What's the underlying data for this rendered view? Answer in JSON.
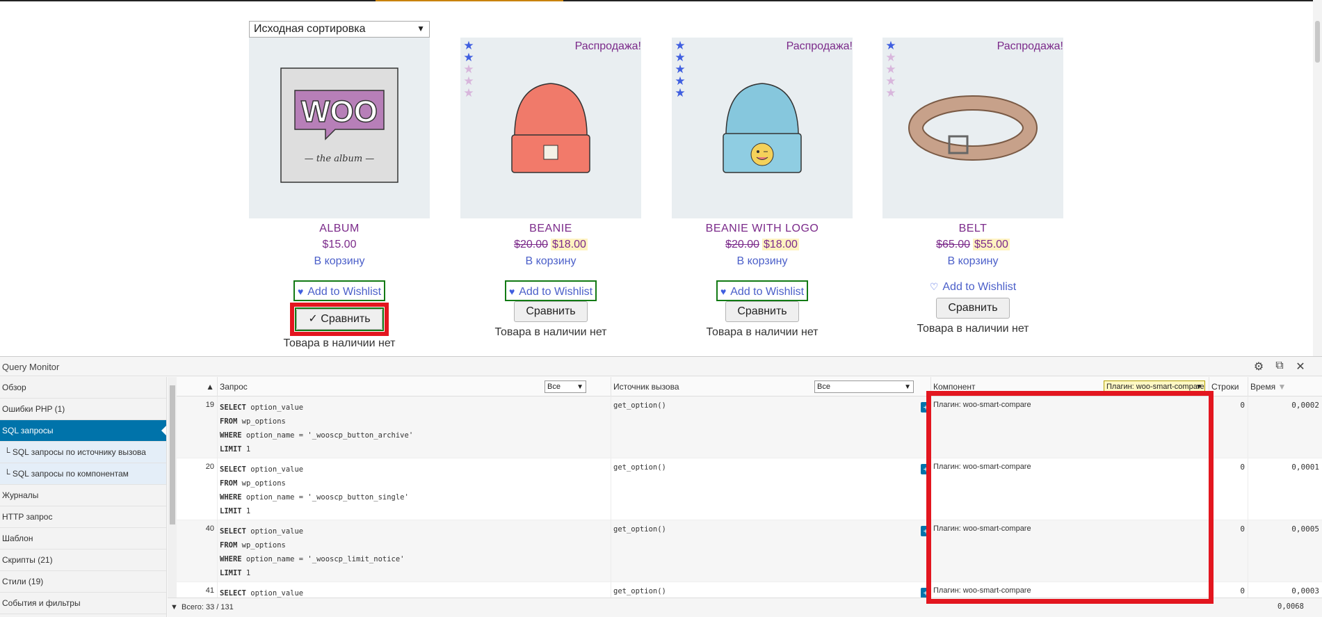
{
  "shop": {
    "sort_value": "Исходная сортировка",
    "products": [
      {
        "title": "ALBUM",
        "price_old": "",
        "price": "$15.00",
        "cart": "В корзину",
        "sale": "",
        "stars": 0,
        "wishlist": "Add to Wishlist",
        "compare": "✓ Сравнить",
        "stock": "Товара в наличии нет"
      },
      {
        "title": "BEANIE",
        "price_old": "$20.00",
        "price": "$18.00",
        "cart": "В корзину",
        "sale": "Распродажа!",
        "stars": 2,
        "wishlist": "Add to Wishlist",
        "compare": "Сравнить",
        "stock": "Товара в наличии нет"
      },
      {
        "title": "BEANIE WITH LOGO",
        "price_old": "$20.00",
        "price": "$18.00",
        "cart": "В корзину",
        "sale": "Распродажа!",
        "stars": 5,
        "wishlist": "Add to Wishlist",
        "compare": "Сравнить",
        "stock": "Товара в наличии нет"
      },
      {
        "title": "BELT",
        "price_old": "$65.00",
        "price": "$55.00",
        "cart": "В корзину",
        "sale": "Распродажа!",
        "stars": 1,
        "wishlist": "Add to Wishlist",
        "compare": "Сравнить",
        "stock": "Товара в наличии нет"
      }
    ]
  },
  "qm": {
    "title": "Query Monitor",
    "nav": [
      "Обзор",
      "Ошибки PHP (1)",
      "SQL запросы",
      "└ SQL запросы по источнику вызова",
      "└ SQL запросы по компонентам",
      "Журналы",
      "HTTP запрос",
      "Шаблон",
      "Скрипты (21)",
      "Стили (19)",
      "События и фильтры"
    ],
    "columns": {
      "sort": "▲",
      "query": "Запрос",
      "query_filter": "Все",
      "caller": "Источник вызова",
      "caller_filter": "Все",
      "component": "Компонент",
      "component_filter": "Плагин: woo-smart-compare",
      "rows": "Строки",
      "time": "Время"
    },
    "rows": [
      {
        "n": "19",
        "sql": [
          "SELECT option_value",
          "FROM wp_options",
          "WHERE option_name = '_wooscp_button_archive'",
          "LIMIT 1"
        ],
        "caller": "get_option()",
        "component": "Плагин: woo-smart-compare",
        "rows": "0",
        "time": "0,0002"
      },
      {
        "n": "20",
        "sql": [
          "SELECT option_value",
          "FROM wp_options",
          "WHERE option_name = '_wooscp_button_single'",
          "LIMIT 1"
        ],
        "caller": "get_option()",
        "component": "Плагин: woo-smart-compare",
        "rows": "0",
        "time": "0,0001"
      },
      {
        "n": "40",
        "sql": [
          "SELECT option_value",
          "FROM wp_options",
          "WHERE option_name = '_wooscp_limit_notice'",
          "LIMIT 1"
        ],
        "caller": "get_option()",
        "component": "Плагин: woo-smart-compare",
        "rows": "0",
        "time": "0,0005"
      },
      {
        "n": "41",
        "sql": [
          "SELECT option_value"
        ],
        "caller": "get_option()",
        "component": "Плагин: woo-smart-compare",
        "rows": "0",
        "time": "0,0003"
      }
    ],
    "footer": {
      "total": "Всего: 33 / 131",
      "time": "0,0068"
    }
  }
}
